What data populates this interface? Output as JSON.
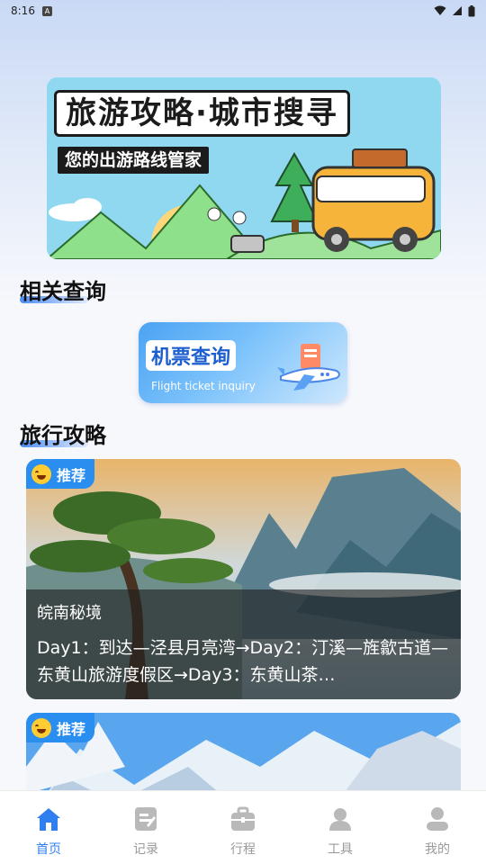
{
  "status_bar": {
    "time": "8:16",
    "a_badge": "A"
  },
  "banner": {
    "title": "旅游攻略·城市搜寻",
    "subtitle": "您的出游路线管家"
  },
  "sections": {
    "related": "相关查询",
    "guides": "旅行攻略"
  },
  "flight_card": {
    "title": "机票查询",
    "subtitle": "Flight ticket inquiry"
  },
  "cards": [
    {
      "tag": "推荐",
      "place": "皖南秘境",
      "description": "Day1：到达—泾县月亮湾→Day2：汀溪—旌歙古道—东黄山旅游度假区→Day3：东黄山茶…"
    },
    {
      "tag": "推荐"
    }
  ],
  "nav": [
    {
      "label": "首页",
      "icon": "home-icon"
    },
    {
      "label": "记录",
      "icon": "record-icon"
    },
    {
      "label": "行程",
      "icon": "briefcase-icon"
    },
    {
      "label": "工具",
      "icon": "person-icon"
    },
    {
      "label": "我的",
      "icon": "profile-icon"
    }
  ],
  "colors": {
    "accent": "#2f7ff0",
    "inactive": "#9a9a9a"
  }
}
